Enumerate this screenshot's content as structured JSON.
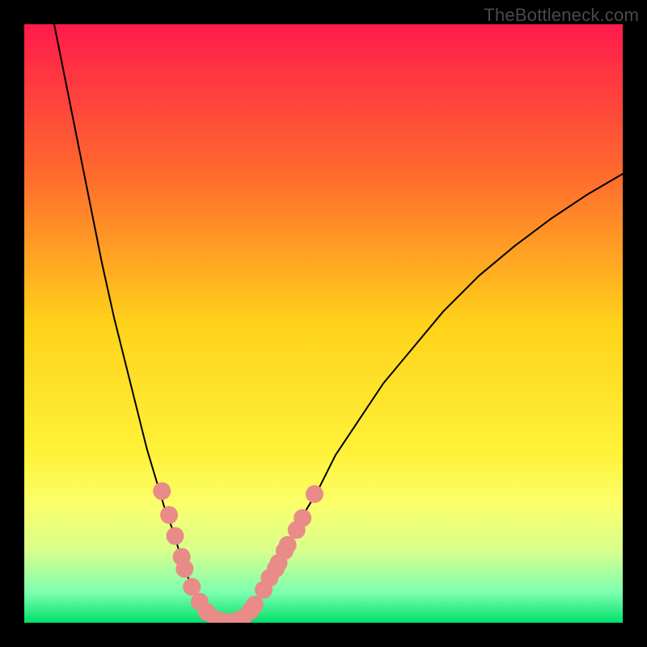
{
  "watermark": "TheBottleneck.com",
  "chart_data": {
    "type": "line",
    "title": "",
    "xlabel": "",
    "ylabel": "",
    "xlim": [
      0,
      100
    ],
    "ylim": [
      0,
      100
    ],
    "gradient_stops": [
      {
        "offset": 0,
        "color": "#ff1b4b"
      },
      {
        "offset": 25,
        "color": "#ff6a2e"
      },
      {
        "offset": 50,
        "color": "#ffd21a"
      },
      {
        "offset": 72,
        "color": "#fff23a"
      },
      {
        "offset": 80,
        "color": "#fbff6b"
      },
      {
        "offset": 88,
        "color": "#d8ff8c"
      },
      {
        "offset": 95,
        "color": "#7cffb0"
      },
      {
        "offset": 100,
        "color": "#00e06a"
      }
    ],
    "series": [
      {
        "name": "curve-left",
        "x": [
          5,
          7,
          9,
          11,
          13,
          15,
          17,
          19,
          20.5,
          22,
          23.5,
          25,
          26,
          27,
          28,
          29,
          30,
          31
        ],
        "values": [
          100,
          90,
          80,
          70,
          60,
          51,
          43,
          35,
          29,
          24,
          19,
          15,
          11.5,
          8.5,
          6,
          4,
          2.5,
          1.3
        ]
      },
      {
        "name": "curve-bottom",
        "x": [
          31,
          32,
          33,
          34,
          35,
          36,
          37
        ],
        "values": [
          1.3,
          0.6,
          0.2,
          0.1,
          0.2,
          0.6,
          1.3
        ]
      },
      {
        "name": "curve-right",
        "x": [
          37,
          38.5,
          40,
          42,
          44,
          46,
          49,
          52,
          56,
          60,
          65,
          70,
          76,
          82,
          88,
          94,
          100
        ],
        "values": [
          1.3,
          3,
          5.3,
          9,
          13,
          17,
          22,
          28,
          34,
          40,
          46,
          52,
          58,
          63,
          67.5,
          71.5,
          75
        ]
      }
    ],
    "markers": {
      "name": "salmon-dots",
      "color": "#e98b89",
      "radius": 11,
      "points": [
        {
          "x": 23.0,
          "y": 22.0
        },
        {
          "x": 24.2,
          "y": 18.0
        },
        {
          "x": 25.2,
          "y": 14.5
        },
        {
          "x": 26.3,
          "y": 11.0
        },
        {
          "x": 26.8,
          "y": 9.0
        },
        {
          "x": 28.0,
          "y": 6.0
        },
        {
          "x": 29.3,
          "y": 3.5
        },
        {
          "x": 30.5,
          "y": 1.8
        },
        {
          "x": 32.0,
          "y": 0.6
        },
        {
          "x": 33.5,
          "y": 0.2
        },
        {
          "x": 35.0,
          "y": 0.2
        },
        {
          "x": 36.5,
          "y": 0.8
        },
        {
          "x": 37.8,
          "y": 2.0
        },
        {
          "x": 38.5,
          "y": 3.0
        },
        {
          "x": 40.0,
          "y": 5.5
        },
        {
          "x": 41.0,
          "y": 7.5
        },
        {
          "x": 42.0,
          "y": 9.0
        },
        {
          "x": 42.5,
          "y": 10.0
        },
        {
          "x": 43.5,
          "y": 12.0
        },
        {
          "x": 44.0,
          "y": 13.0
        },
        {
          "x": 45.5,
          "y": 15.5
        },
        {
          "x": 46.5,
          "y": 17.5
        },
        {
          "x": 48.5,
          "y": 21.5
        }
      ]
    }
  }
}
